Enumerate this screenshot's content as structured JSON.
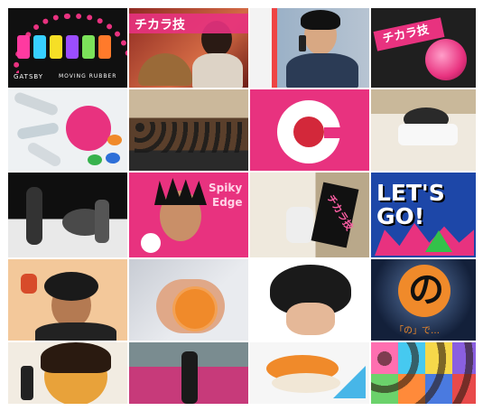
{
  "collage": {
    "tiles": [
      {
        "text": "GATSBY",
        "sub": "MOVING RUBBER"
      },
      {
        "text": "チカラ技"
      },
      {
        "text": ""
      },
      {
        "text": "チカラ技"
      },
      {
        "text": ""
      },
      {
        "text": ""
      },
      {
        "text": ""
      },
      {
        "text": ""
      },
      {
        "text": ""
      },
      {
        "text": "Spiky",
        "sub": "Edge"
      },
      {
        "text": "チカラ技"
      },
      {
        "text": "LET'S GO!"
      },
      {
        "text": ""
      },
      {
        "text": ""
      },
      {
        "text": ""
      },
      {
        "text": "の",
        "sub": "「の」で…"
      },
      {
        "text": ""
      },
      {
        "text": ""
      },
      {
        "text": ""
      },
      {
        "text": ""
      }
    ]
  },
  "colors": {
    "pink": "#e8327f",
    "dark": "#1a1a1a",
    "cream": "#f1e7d6",
    "orange": "#f08a2a",
    "blue": "#1d47a8"
  }
}
